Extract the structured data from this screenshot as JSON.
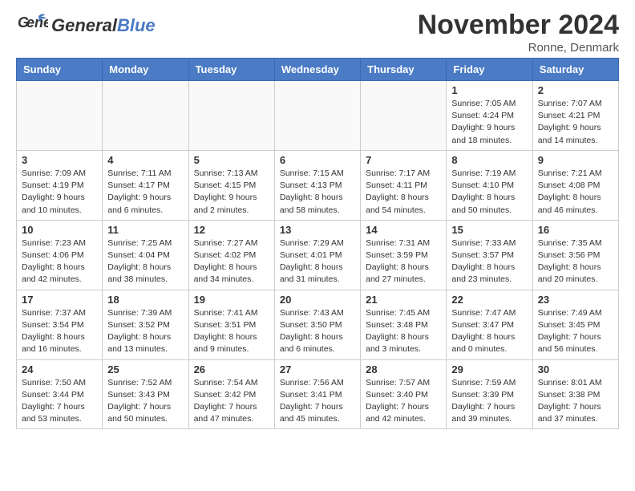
{
  "header": {
    "logo_general": "General",
    "logo_blue": "Blue",
    "title": "November 2024",
    "location": "Ronne, Denmark"
  },
  "weekdays": [
    "Sunday",
    "Monday",
    "Tuesday",
    "Wednesday",
    "Thursday",
    "Friday",
    "Saturday"
  ],
  "weeks": [
    [
      {
        "day": "",
        "info": ""
      },
      {
        "day": "",
        "info": ""
      },
      {
        "day": "",
        "info": ""
      },
      {
        "day": "",
        "info": ""
      },
      {
        "day": "",
        "info": ""
      },
      {
        "day": "1",
        "info": "Sunrise: 7:05 AM\nSunset: 4:24 PM\nDaylight: 9 hours and 18 minutes."
      },
      {
        "day": "2",
        "info": "Sunrise: 7:07 AM\nSunset: 4:21 PM\nDaylight: 9 hours and 14 minutes."
      }
    ],
    [
      {
        "day": "3",
        "info": "Sunrise: 7:09 AM\nSunset: 4:19 PM\nDaylight: 9 hours and 10 minutes."
      },
      {
        "day": "4",
        "info": "Sunrise: 7:11 AM\nSunset: 4:17 PM\nDaylight: 9 hours and 6 minutes."
      },
      {
        "day": "5",
        "info": "Sunrise: 7:13 AM\nSunset: 4:15 PM\nDaylight: 9 hours and 2 minutes."
      },
      {
        "day": "6",
        "info": "Sunrise: 7:15 AM\nSunset: 4:13 PM\nDaylight: 8 hours and 58 minutes."
      },
      {
        "day": "7",
        "info": "Sunrise: 7:17 AM\nSunset: 4:11 PM\nDaylight: 8 hours and 54 minutes."
      },
      {
        "day": "8",
        "info": "Sunrise: 7:19 AM\nSunset: 4:10 PM\nDaylight: 8 hours and 50 minutes."
      },
      {
        "day": "9",
        "info": "Sunrise: 7:21 AM\nSunset: 4:08 PM\nDaylight: 8 hours and 46 minutes."
      }
    ],
    [
      {
        "day": "10",
        "info": "Sunrise: 7:23 AM\nSunset: 4:06 PM\nDaylight: 8 hours and 42 minutes."
      },
      {
        "day": "11",
        "info": "Sunrise: 7:25 AM\nSunset: 4:04 PM\nDaylight: 8 hours and 38 minutes."
      },
      {
        "day": "12",
        "info": "Sunrise: 7:27 AM\nSunset: 4:02 PM\nDaylight: 8 hours and 34 minutes."
      },
      {
        "day": "13",
        "info": "Sunrise: 7:29 AM\nSunset: 4:01 PM\nDaylight: 8 hours and 31 minutes."
      },
      {
        "day": "14",
        "info": "Sunrise: 7:31 AM\nSunset: 3:59 PM\nDaylight: 8 hours and 27 minutes."
      },
      {
        "day": "15",
        "info": "Sunrise: 7:33 AM\nSunset: 3:57 PM\nDaylight: 8 hours and 23 minutes."
      },
      {
        "day": "16",
        "info": "Sunrise: 7:35 AM\nSunset: 3:56 PM\nDaylight: 8 hours and 20 minutes."
      }
    ],
    [
      {
        "day": "17",
        "info": "Sunrise: 7:37 AM\nSunset: 3:54 PM\nDaylight: 8 hours and 16 minutes."
      },
      {
        "day": "18",
        "info": "Sunrise: 7:39 AM\nSunset: 3:52 PM\nDaylight: 8 hours and 13 minutes."
      },
      {
        "day": "19",
        "info": "Sunrise: 7:41 AM\nSunset: 3:51 PM\nDaylight: 8 hours and 9 minutes."
      },
      {
        "day": "20",
        "info": "Sunrise: 7:43 AM\nSunset: 3:50 PM\nDaylight: 8 hours and 6 minutes."
      },
      {
        "day": "21",
        "info": "Sunrise: 7:45 AM\nSunset: 3:48 PM\nDaylight: 8 hours and 3 minutes."
      },
      {
        "day": "22",
        "info": "Sunrise: 7:47 AM\nSunset: 3:47 PM\nDaylight: 8 hours and 0 minutes."
      },
      {
        "day": "23",
        "info": "Sunrise: 7:49 AM\nSunset: 3:45 PM\nDaylight: 7 hours and 56 minutes."
      }
    ],
    [
      {
        "day": "24",
        "info": "Sunrise: 7:50 AM\nSunset: 3:44 PM\nDaylight: 7 hours and 53 minutes."
      },
      {
        "day": "25",
        "info": "Sunrise: 7:52 AM\nSunset: 3:43 PM\nDaylight: 7 hours and 50 minutes."
      },
      {
        "day": "26",
        "info": "Sunrise: 7:54 AM\nSunset: 3:42 PM\nDaylight: 7 hours and 47 minutes."
      },
      {
        "day": "27",
        "info": "Sunrise: 7:56 AM\nSunset: 3:41 PM\nDaylight: 7 hours and 45 minutes."
      },
      {
        "day": "28",
        "info": "Sunrise: 7:57 AM\nSunset: 3:40 PM\nDaylight: 7 hours and 42 minutes."
      },
      {
        "day": "29",
        "info": "Sunrise: 7:59 AM\nSunset: 3:39 PM\nDaylight: 7 hours and 39 minutes."
      },
      {
        "day": "30",
        "info": "Sunrise: 8:01 AM\nSunset: 3:38 PM\nDaylight: 7 hours and 37 minutes."
      }
    ]
  ]
}
